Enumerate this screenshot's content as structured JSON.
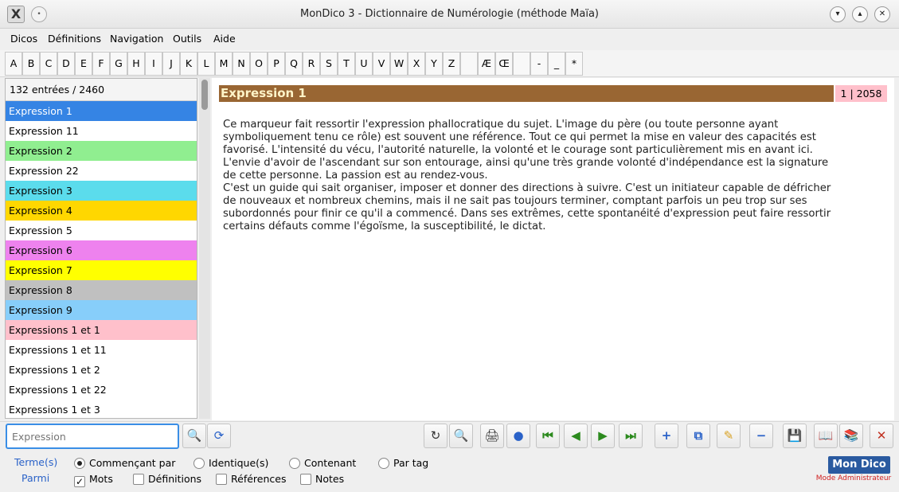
{
  "window": {
    "title": "MonDico 3 - Dictionnaire de Numérologie (méthode Maïa)",
    "app_icon": "X",
    "controls": [
      "minimize-icon",
      "maximize-icon",
      "close-icon"
    ]
  },
  "menu": [
    "Dicos",
    "Définitions",
    "Navigation",
    "Outils",
    "Aide"
  ],
  "alphabet": [
    "A",
    "B",
    "C",
    "D",
    "E",
    "F",
    "G",
    "H",
    "I",
    "J",
    "K",
    "L",
    "M",
    "N",
    "O",
    "P",
    "Q",
    "R",
    "S",
    "T",
    "U",
    "V",
    "W",
    "X",
    "Y",
    "Z",
    "",
    "Æ",
    "Œ",
    "",
    "-",
    "_",
    "*"
  ],
  "list": {
    "count_label": "132 entrées / 2460",
    "items": [
      {
        "label": "Expression 1",
        "bg": "#3584e4",
        "fg": "#ffffff"
      },
      {
        "label": "Expression 11",
        "bg": "#ffffff",
        "fg": "#000000"
      },
      {
        "label": "Expression 2",
        "bg": "#90ee90",
        "fg": "#000000"
      },
      {
        "label": "Expression 22",
        "bg": "#ffffff",
        "fg": "#000000"
      },
      {
        "label": "Expression 3",
        "bg": "#5bdcec",
        "fg": "#000000"
      },
      {
        "label": "Expression 4",
        "bg": "#ffd700",
        "fg": "#000000"
      },
      {
        "label": "Expression 5",
        "bg": "#ffffff",
        "fg": "#000000"
      },
      {
        "label": "Expression 6",
        "bg": "#ee82ee",
        "fg": "#000000"
      },
      {
        "label": "Expression 7",
        "bg": "#ffff00",
        "fg": "#000000"
      },
      {
        "label": "Expression 8",
        "bg": "#c0c0c0",
        "fg": "#000000"
      },
      {
        "label": "Expression 9",
        "bg": "#87cefa",
        "fg": "#000000"
      },
      {
        "label": "Expressions 1 et 1",
        "bg": "#ffc0cb",
        "fg": "#000000"
      },
      {
        "label": "Expressions 1 et 11",
        "bg": "#ffffff",
        "fg": "#000000"
      },
      {
        "label": "Expressions 1 et 2",
        "bg": "#ffffff",
        "fg": "#000000"
      },
      {
        "label": "Expressions 1 et 22",
        "bg": "#ffffff",
        "fg": "#000000"
      },
      {
        "label": "Expressions 1 et 3",
        "bg": "#ffffff",
        "fg": "#000000"
      }
    ]
  },
  "entry": {
    "title": "Expression 1",
    "position": "1 | 2058",
    "text_lines": [
      "Ce marqueur fait ressortir l'expression phallocratique du sujet. L'image du père (ou toute personne ayant",
      "symboliquement tenu ce rôle) est souvent une référence. Tout ce qui permet la mise en valeur des capacités est",
      "favorisé. L'intensité du vécu, l'autorité naturelle, la volonté et le courage sont particulièrement mis en avant ici.",
      "L'envie d'avoir de l'ascendant sur son entourage, ainsi qu'une très grande volonté d'indépendance est la signature",
      "de cette personne. La passion est au rendez-vous.",
      "C'est un guide qui sait organiser, imposer et donner des directions à suivre. C'est un initiateur capable de défricher",
      "de nouveaux et nombreux chemins, mais il ne sait pas toujours terminer, comptant parfois un peu trop sur ses",
      "subordonnés pour finir ce qu'il a commencé. Dans ses extrêmes, cette spontanéité d'expression peut faire ressortir",
      "certains défauts comme l'égoïsme, la susceptibilité, le dictat."
    ]
  },
  "search": {
    "placeholder": "Expression"
  },
  "options": {
    "termes_label": "Terme(s)",
    "parmi_label": "Parmi",
    "radios": [
      {
        "label": "Commençant par",
        "checked": true
      },
      {
        "label": "Identique(s)",
        "checked": false
      },
      {
        "label": "Contenant",
        "checked": false
      },
      {
        "label": "Par tag",
        "checked": false
      }
    ],
    "checks": [
      {
        "label": "Mots",
        "checked": true
      },
      {
        "label": "Définitions",
        "checked": false
      },
      {
        "label": "Références",
        "checked": false
      },
      {
        "label": "Notes",
        "checked": false
      }
    ]
  },
  "logo": {
    "text": "Mon Dico",
    "subtitle": "Mode Administrateur"
  },
  "colors": {
    "header_bg": "#996633",
    "header_fg": "#fff4c8",
    "position_bg": "#ffc0cb",
    "accent": "#2a62c8"
  }
}
